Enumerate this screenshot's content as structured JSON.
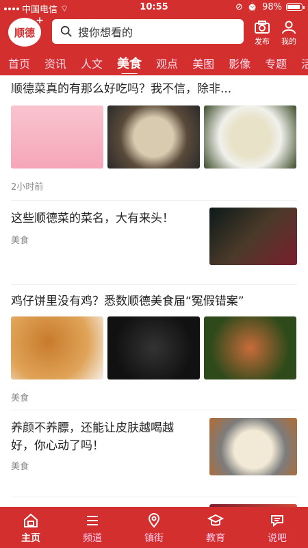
{
  "statusbar": {
    "carrier": "中国电信",
    "time": "10:55",
    "battery": "98%"
  },
  "header": {
    "logo_text": "顺德",
    "logo_plus": "+",
    "search_placeholder": "搜你想看的",
    "publish_label": "发布",
    "mine_label": "我的"
  },
  "tabs": [
    "首页",
    "资讯",
    "人文",
    "美食",
    "观点",
    "美图",
    "影像",
    "专题",
    "活"
  ],
  "active_tab": "美食",
  "articles": [
    {
      "title": "顺德菜真的有那么好吃吗？我不信，除非...",
      "meta": "2小时前"
    },
    {
      "title": "这些顺德菜的菜名，大有来头！",
      "meta": "美食"
    },
    {
      "title": "鸡仔饼里没有鸡？悉数顺德美食届“冤假错案”",
      "meta": "美食"
    },
    {
      "title_line1": "养颜不养膘，还能让皮肤越喝越",
      "title_line2": "好，你心动了吗！",
      "meta": "美食"
    }
  ],
  "bottom_nav": [
    {
      "label": "主页",
      "icon": "home-icon",
      "active": true
    },
    {
      "label": "频道",
      "icon": "menu-icon",
      "active": false
    },
    {
      "label": "镇街",
      "icon": "location-icon",
      "active": false
    },
    {
      "label": "教育",
      "icon": "graduation-icon",
      "active": false
    },
    {
      "label": "说吧",
      "icon": "chat-icon",
      "active": false
    }
  ],
  "colors": {
    "brand": "#d32f2f"
  }
}
